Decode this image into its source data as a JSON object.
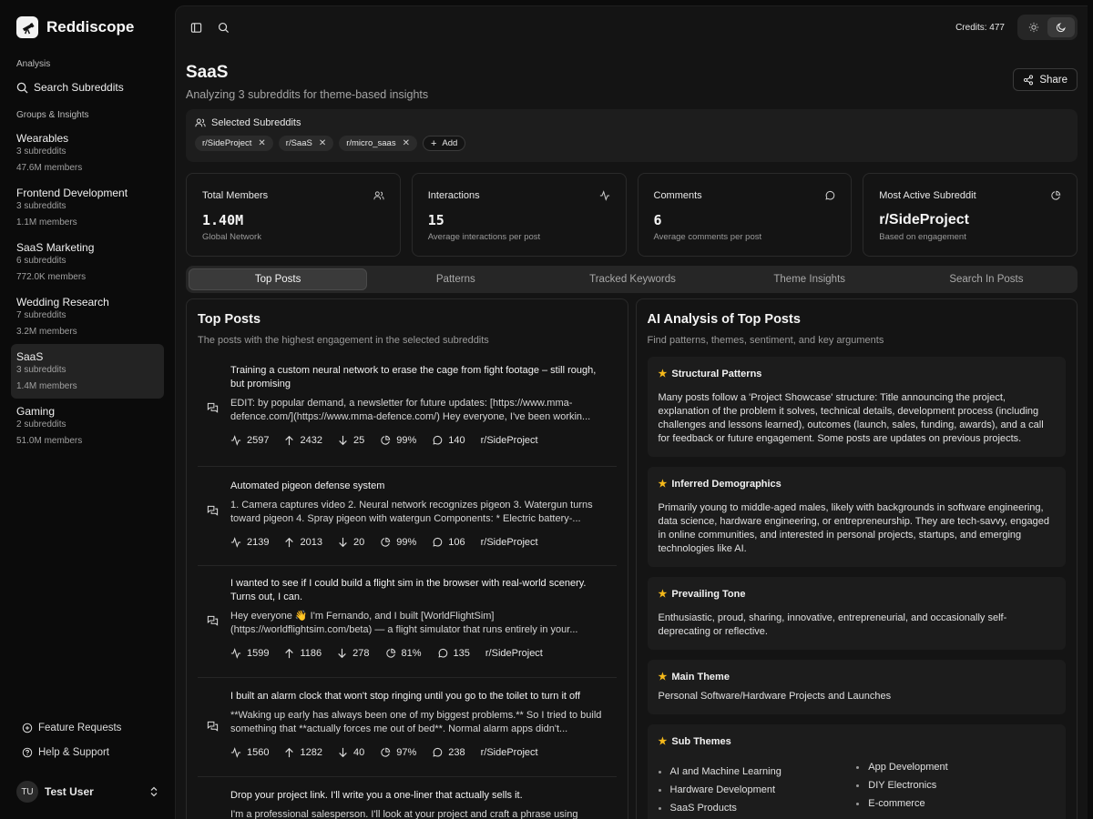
{
  "brand": {
    "name": "Reddiscope"
  },
  "sidebar": {
    "analysis_label": "Analysis",
    "search_label": "Search Subreddits",
    "groups_label": "Groups & Insights",
    "groups": [
      {
        "name": "Wearables",
        "count": "3 subreddits",
        "members": "47.6M members"
      },
      {
        "name": "Frontend Development",
        "count": "3 subreddits",
        "members": "1.1M members"
      },
      {
        "name": "SaaS Marketing",
        "count": "6 subreddits",
        "members": "772.0K members"
      },
      {
        "name": "Wedding Research",
        "count": "7 subreddits",
        "members": "3.2M members"
      },
      {
        "name": "SaaS",
        "count": "3 subreddits",
        "members": "1.4M members"
      },
      {
        "name": "Gaming",
        "count": "2 subreddits",
        "members": "51.0M members"
      }
    ],
    "feature_requests": "Feature Requests",
    "help": "Help & Support",
    "user": {
      "initials": "TU",
      "name": "Test User"
    }
  },
  "topbar": {
    "credits": "Credits: 477"
  },
  "page": {
    "title": "SaaS",
    "subtitle": "Analyzing 3 subreddits for theme-based insights",
    "share": "Share"
  },
  "selected": {
    "label": "Selected Subreddits",
    "chips": [
      "r/SideProject",
      "r/SaaS",
      "r/micro_saas"
    ],
    "add": "Add"
  },
  "stats": [
    {
      "title": "Total Members",
      "value": "1.40M",
      "sub": "Global Network"
    },
    {
      "title": "Interactions",
      "value": "15",
      "sub": "Average interactions per post"
    },
    {
      "title": "Comments",
      "value": "6",
      "sub": "Average comments per post"
    },
    {
      "title": "Most Active Subreddit",
      "value": "r/SideProject",
      "sub": "Based on engagement"
    }
  ],
  "tabs": [
    "Top Posts",
    "Patterns",
    "Tracked Keywords",
    "Theme Insights",
    "Search In Posts"
  ],
  "top_posts": {
    "title": "Top Posts",
    "subtitle": "The posts with the highest engagement in the selected subreddits",
    "posts": [
      {
        "title": "Training a custom neural network to erase the cage from fight footage – still rough, but promising",
        "body": "EDIT: by popular demand, a newsletter for future updates: [https://www.mma-defence.com/](https://www.mma-defence.com/) Hey everyone, I've been workin...",
        "interactions": "2597",
        "upvotes": "2432",
        "downvotes": "25",
        "ratio": "99%",
        "comments": "140",
        "subreddit": "r/SideProject"
      },
      {
        "title": "Automated pigeon defense system",
        "body": "1. Camera captures video 2. Neural network recognizes pigeon 3. Watergun turns toward pigeon 4. Spray pigeon with watergun Components: * Electric battery-...",
        "interactions": "2139",
        "upvotes": "2013",
        "downvotes": "20",
        "ratio": "99%",
        "comments": "106",
        "subreddit": "r/SideProject"
      },
      {
        "title": "I wanted to see if I could build a flight sim in the browser with real-world scenery. Turns out, I can.",
        "body": "Hey everyone 👋 I'm Fernando, and I built [WorldFlightSim](https://worldflightsim.com/beta) — a flight simulator that runs entirely in your...",
        "interactions": "1599",
        "upvotes": "1186",
        "downvotes": "278",
        "ratio": "81%",
        "comments": "135",
        "subreddit": "r/SideProject"
      },
      {
        "title": "I built an alarm clock that won't stop ringing until you go to the toilet to turn it off",
        "body": "**Waking up early has always been one of my biggest problems.** So I tried to build something that **actually forces me out of bed**. Normal alarm apps didn't...",
        "interactions": "1560",
        "upvotes": "1282",
        "downvotes": "40",
        "ratio": "97%",
        "comments": "238",
        "subreddit": "r/SideProject"
      },
      {
        "title": "Drop your project link. I'll write you a one-liner that actually sells it.",
        "body": "I'm a professional salesperson. I'll look at your project and craft a phrase using real...",
        "interactions": "",
        "upvotes": "",
        "downvotes": "",
        "ratio": "",
        "comments": "",
        "subreddit": ""
      }
    ]
  },
  "ai_analysis": {
    "title": "AI Analysis of Top Posts",
    "subtitle": "Find patterns, themes, sentiment, and key arguments",
    "cards": [
      {
        "title": "Structural Patterns",
        "body": "Many posts follow a 'Project Showcase' structure: Title announcing the project, explanation of the problem it solves, technical details, development process (including challenges and lessons learned), outcomes (launch, sales, funding, awards), and a call for feedback or future engagement. Some posts are updates on previous projects."
      },
      {
        "title": "Inferred Demographics",
        "body": "Primarily young to middle-aged males, likely with backgrounds in software engineering, data science, hardware engineering, or entrepreneurship. They are tech-savvy, engaged in online communities, and interested in personal projects, startups, and emerging technologies like AI."
      },
      {
        "title": "Prevailing Tone",
        "body": "Enthusiastic, proud, sharing, innovative, entrepreneurial, and occasionally self-deprecating or reflective."
      },
      {
        "title": "Main Theme",
        "body": "Personal Software/Hardware Projects and Launches"
      }
    ],
    "sub_themes": {
      "title": "Sub Themes",
      "left": [
        "AI and Machine Learning",
        "Hardware Development",
        "SaaS Products"
      ],
      "right": [
        "App Development",
        "DIY Electronics",
        "E-commerce"
      ]
    }
  }
}
